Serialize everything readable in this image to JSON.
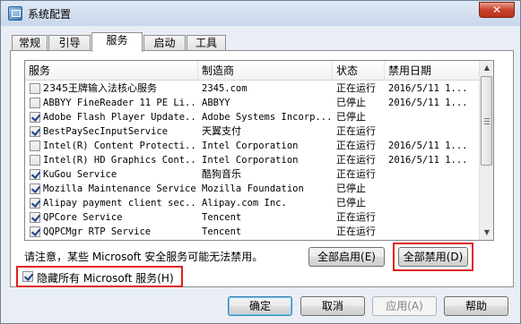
{
  "window": {
    "title": "系统配置",
    "close_glyph": "✕"
  },
  "tabs": [
    {
      "label": "常规"
    },
    {
      "label": "引导"
    },
    {
      "label": "服务"
    },
    {
      "label": "启动"
    },
    {
      "label": "工具"
    }
  ],
  "active_tab": "服务",
  "columns": {
    "service": "服务",
    "manufacturer": "制造商",
    "status": "状态",
    "disabled_date": "禁用日期"
  },
  "services": [
    {
      "checked": false,
      "name": "2345王牌输入法核心服务",
      "manufacturer": "2345.com",
      "status": "正在运行",
      "date": "2016/5/11 1..."
    },
    {
      "checked": false,
      "name": "ABBYY FineReader 11 PE Li...",
      "manufacturer": "ABBYY",
      "status": "已停止",
      "date": "2016/5/11 1..."
    },
    {
      "checked": true,
      "name": "Adobe Flash Player Update...",
      "manufacturer": "Adobe Systems Incorp...",
      "status": "已停止",
      "date": ""
    },
    {
      "checked": true,
      "name": "BestPaySecInputService",
      "manufacturer": "天翼支付",
      "status": "正在运行",
      "date": ""
    },
    {
      "checked": false,
      "name": "Intel(R) Content Protecti...",
      "manufacturer": "Intel Corporation",
      "status": "正在运行",
      "date": "2016/5/11 1..."
    },
    {
      "checked": false,
      "name": "Intel(R) HD Graphics Cont...",
      "manufacturer": "Intel Corporation",
      "status": "正在运行",
      "date": "2016/5/11 1..."
    },
    {
      "checked": true,
      "name": "KuGou Service",
      "manufacturer": "酷狗音乐",
      "status": "正在运行",
      "date": ""
    },
    {
      "checked": true,
      "name": "Mozilla Maintenance Service",
      "manufacturer": "Mozilla Foundation",
      "status": "已停止",
      "date": ""
    },
    {
      "checked": true,
      "name": "Alipay payment client sec...",
      "manufacturer": "Alipay.com Inc.",
      "status": "已停止",
      "date": ""
    },
    {
      "checked": true,
      "name": "QPCore Service",
      "manufacturer": "Tencent",
      "status": "正在运行",
      "date": ""
    },
    {
      "checked": true,
      "name": "QQPCMgr RTP Service",
      "manufacturer": "Tencent",
      "status": "正在运行",
      "date": ""
    }
  ],
  "note": "请注意，某些 Microsoft 安全服务可能无法禁用。",
  "buttons": {
    "enable_all": "全部启用(E)",
    "disable_all": "全部禁用(D)",
    "ok": "确定",
    "cancel": "取消",
    "apply": "应用(A)",
    "help": "帮助"
  },
  "hide_ms": {
    "label": "隐藏所有 Microsoft 服务(H)",
    "checked": true
  },
  "scroll": {
    "up_glyph": "▲",
    "down_glyph": "▼"
  },
  "colors": {
    "highlight": "#e02020",
    "accent": "#3c7fb1"
  }
}
